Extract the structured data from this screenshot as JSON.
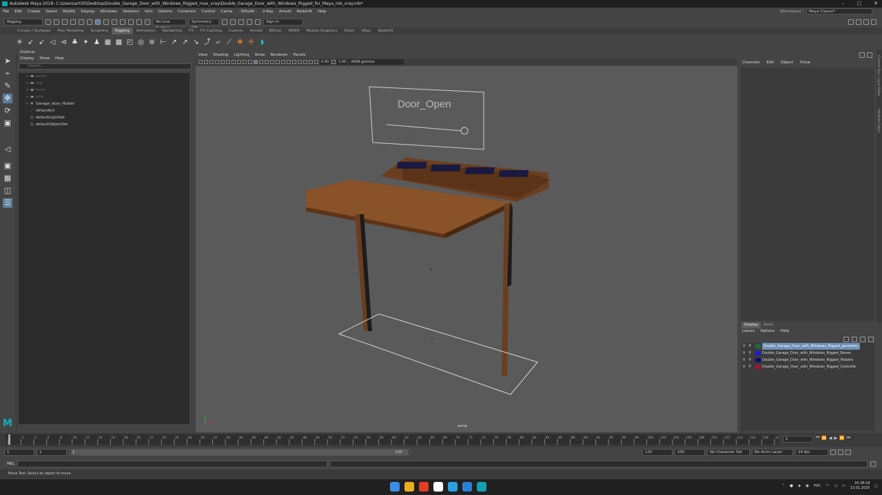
{
  "window": {
    "title": "Autodesk Maya 2018: C:\\Users\\art30\\Desktop\\Double_Garage_Door_with_Windows_Rigged_max_vray\\Double_Garage_Door_with_Windows_Rigged_for_Maya_mb_vray.mb*"
  },
  "menubar": [
    "File",
    "Edit",
    "Create",
    "Select",
    "Modify",
    "Display",
    "Windows",
    "Skeleton",
    "Skin",
    "Deform",
    "Constrain",
    "Control",
    "Cache",
    "- 3DtoAll -",
    "V-Ray",
    "Arnold",
    "Redshift",
    "Help"
  ],
  "workspace": {
    "label": "Workspace :",
    "value": "Maya Classic*"
  },
  "statusline": {
    "mode": "Rigging",
    "live_surface": "No Live Surface",
    "symmetry": "Symmetry: Off",
    "sign_in": "Sign In"
  },
  "shelf_tabs": [
    "Curves / Surfaces",
    "Poly Modeling",
    "Sculpting",
    "Rigging",
    "Animation",
    "Rendering",
    "FX",
    "FX Caching",
    "Custom",
    "Arnold",
    "Bifrost",
    "MASH",
    "Motion Graphics",
    "XGen",
    "VRay",
    "Redshift"
  ],
  "active_shelf": "Rigging",
  "outliner": {
    "title": "Outliner",
    "menu": [
      "Display",
      "Show",
      "Help"
    ],
    "search_placeholder": "Search...",
    "items": [
      {
        "label": "persp",
        "icon": "camera-icon",
        "dim": true,
        "expand": "+"
      },
      {
        "label": "top",
        "icon": "camera-icon",
        "dim": true,
        "expand": "+"
      },
      {
        "label": "front",
        "icon": "camera-icon",
        "dim": true,
        "expand": "+"
      },
      {
        "label": "side",
        "icon": "camera-icon",
        "dim": true,
        "expand": "+"
      },
      {
        "label": "Garage_door_Holder",
        "icon": "transform-icon",
        "dim": false,
        "expand": "+"
      },
      {
        "label": "ikHandle1",
        "icon": "ik-handle-icon",
        "dim": false,
        "expand": ""
      },
      {
        "label": "defaultLightSet",
        "icon": "set-icon",
        "dim": false,
        "expand": ""
      },
      {
        "label": "defaultObjectSet",
        "icon": "set-icon",
        "dim": false,
        "expand": ""
      }
    ]
  },
  "viewport": {
    "menu": [
      "View",
      "Shading",
      "Lighting",
      "Show",
      "Renderer",
      "Panels"
    ],
    "exposure": "0.00",
    "gamma": "1.00",
    "color_space": "sRGB gamma",
    "camera": "persp",
    "control_label": "Door_Open"
  },
  "channel_box": {
    "menu": [
      "Channels",
      "Edit",
      "Object",
      "Show"
    ],
    "side_tabs": [
      "Channel Box / Layer Editor",
      "Attribute Editor"
    ]
  },
  "layer_editor": {
    "tabs": [
      "Display",
      "Anim"
    ],
    "menu": [
      "Layers",
      "Options",
      "Help"
    ],
    "layers": [
      {
        "v": "V",
        "p": "P",
        "color": "#1f6b3a",
        "name": "Double_Garage_Door_with_Windows_Rigged_geometry",
        "selected": true
      },
      {
        "v": "V",
        "p": "P",
        "color": "#1a1ae0",
        "name": "Double_Garage_Door_with_Windows_Rigged_Bones",
        "selected": false
      },
      {
        "v": "V",
        "p": "P",
        "color": "#0d0d70",
        "name": "Double_Garage_Door_with_Windows_Rigged_Helpers",
        "selected": false
      },
      {
        "v": "V",
        "p": "P",
        "color": "#a0143a",
        "name": "Double_Garage_Door_with_Windows_Rigged_Controlle",
        "selected": false
      }
    ]
  },
  "timeslider": {
    "ticks": [
      "1",
      "2",
      "4",
      "6",
      "8",
      "10",
      "12",
      "14",
      "16",
      "18",
      "20",
      "22",
      "24",
      "26",
      "28",
      "30",
      "32",
      "34",
      "36",
      "38",
      "40",
      "42",
      "44",
      "46",
      "48",
      "50",
      "52",
      "54",
      "56",
      "58",
      "60",
      "62",
      "64",
      "66",
      "68",
      "70",
      "72",
      "74",
      "76",
      "78",
      "80",
      "82",
      "84",
      "86",
      "88",
      "90",
      "92",
      "94",
      "96",
      "98",
      "100",
      "102",
      "104",
      "106",
      "108",
      "110",
      "112",
      "114",
      "116",
      "118",
      "120"
    ],
    "current_frame": "1"
  },
  "range": {
    "start": "1",
    "start2": "1",
    "inner_start": "1",
    "inner_end": "120",
    "end": "120",
    "end2": "200",
    "character_set": "No Character Set",
    "anim_layer": "No Anim Layer",
    "fps": "24 fps"
  },
  "mel": {
    "label": "MEL"
  },
  "help_line": "Move Tool: Select an object to move.",
  "taskbar": {
    "lang": "РУС",
    "time": "16:28:18",
    "date": "13.01.2025",
    "apps": [
      {
        "name": "start",
        "color": "#3a8ee6"
      },
      {
        "name": "explorer",
        "color": "#e8b020"
      },
      {
        "name": "app-red",
        "color": "#e04020"
      },
      {
        "name": "yandex",
        "color": "#ffffff"
      },
      {
        "name": "telegram",
        "color": "#2aa0e0"
      },
      {
        "name": "app-3",
        "color": "#2a7fd0"
      },
      {
        "name": "maya",
        "color": "#12a0b0"
      }
    ]
  }
}
